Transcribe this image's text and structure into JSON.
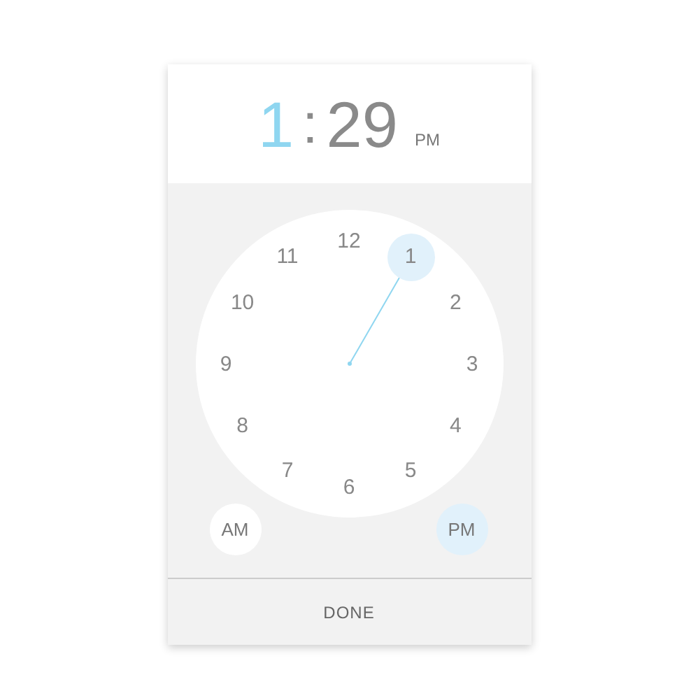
{
  "header": {
    "hours": "1",
    "separator": ":",
    "minutes": "29",
    "meridiem": "PM",
    "hours_selected": true
  },
  "clock_numbers": [
    {
      "label": "12",
      "selected": false
    },
    {
      "label": "1",
      "selected": true
    },
    {
      "label": "2",
      "selected": false
    },
    {
      "label": "3",
      "selected": false
    },
    {
      "label": "4",
      "selected": false
    },
    {
      "label": "5",
      "selected": false
    },
    {
      "label": "6",
      "selected": false
    },
    {
      "label": "7",
      "selected": false
    },
    {
      "label": "8",
      "selected": false
    },
    {
      "label": "9",
      "selected": false
    },
    {
      "label": "10",
      "selected": false
    },
    {
      "label": "11",
      "selected": false
    }
  ],
  "meridiem_buttons": [
    {
      "label": "AM",
      "selected": false
    },
    {
      "label": "PM",
      "selected": true
    }
  ],
  "done_button": "DONE"
}
